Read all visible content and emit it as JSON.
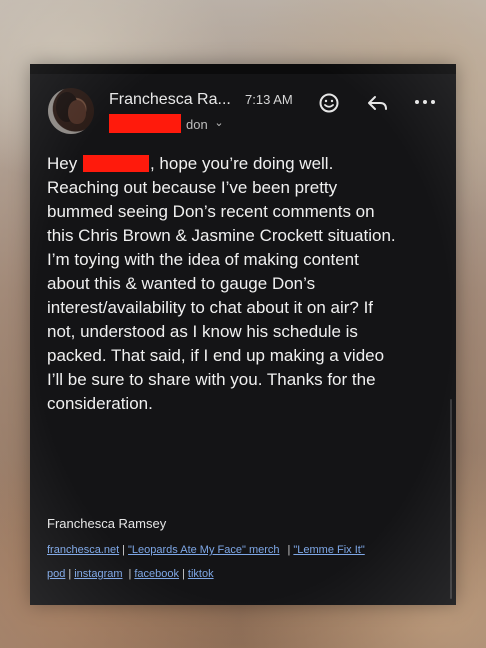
{
  "header": {
    "sender_name": "Franchesca Ra...",
    "time": "7:13 AM",
    "recipient": "don",
    "chevron": "⌄"
  },
  "icons": {
    "emoji": "emoji-icon",
    "reply": "reply-icon",
    "more": "more-icon"
  },
  "body": {
    "greeting": "Hey",
    "greeting_rest": ", hope you’re doing well.",
    "lines": [
      "Reaching out because I’ve been pretty",
      "bummed seeing Don’s recent comments on",
      "this Chris Brown & Jasmine Crockett situation.",
      "I’m toying with the idea of making content",
      "about this & wanted to gauge Don’s",
      "interest/availability to chat about it on air? If",
      "not, understood as I know his schedule is",
      "packed. That said, if I end up making a video",
      "I’ll be sure to share with you. Thanks for the",
      "consideration."
    ]
  },
  "signature": {
    "name": "Franchesca Ramsey",
    "links_row1": [
      "franchesca.net",
      "\"Leopards Ate My Face\" merch",
      "\"Lemme Fix It\""
    ],
    "links_row2": [
      "pod",
      "instagram",
      "facebook",
      "tiktok"
    ],
    "separator": "|"
  },
  "colors": {
    "redaction": "#ff1a0c",
    "link": "#7ea7e6",
    "panel_bg": "#141416"
  }
}
